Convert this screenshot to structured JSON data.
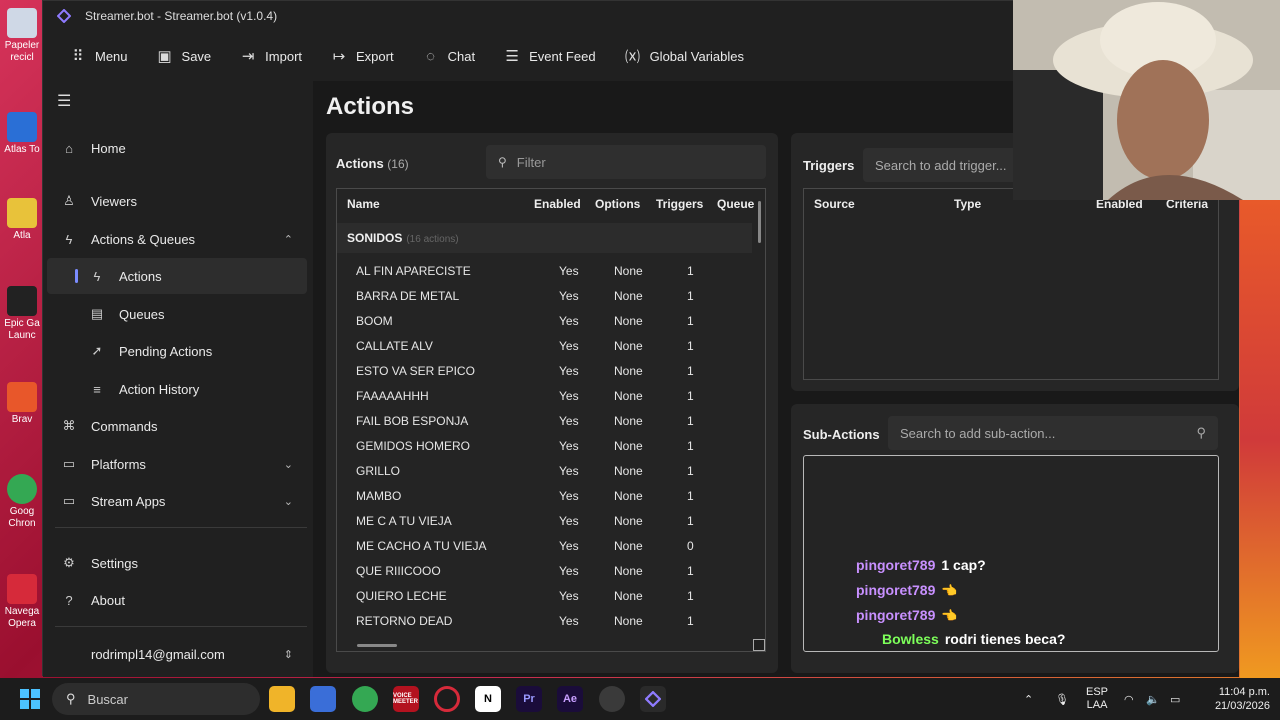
{
  "desktop": {
    "icons": [
      {
        "label": "Papeler recicl",
        "color": "#cfd8e6"
      },
      {
        "label": "Atlas To",
        "color": "#2a6fd6"
      },
      {
        "label": "Atla",
        "color": "#e8c23a"
      },
      {
        "label": "Epic Ga Launc",
        "color": "#222222"
      },
      {
        "label": "Brav",
        "color": "#e8572a"
      },
      {
        "label": "Goog Chron",
        "color": "#34a853"
      },
      {
        "label": "Navega Opera",
        "color": "#d62a3a"
      }
    ]
  },
  "window": {
    "title": "Streamer.bot - Streamer.bot (v1.0.4)",
    "toolbar": [
      {
        "label": "Menu",
        "icon": "grid-icon"
      },
      {
        "label": "Save",
        "icon": "save-icon"
      },
      {
        "label": "Import",
        "icon": "import-icon"
      },
      {
        "label": "Export",
        "icon": "export-icon"
      },
      {
        "label": "Chat",
        "icon": "chat-icon"
      },
      {
        "label": "Event Feed",
        "icon": "event-feed-icon"
      },
      {
        "label": "Global Variables",
        "icon": "variables-icon"
      }
    ]
  },
  "sidebar": {
    "items": [
      {
        "label": "Home"
      },
      {
        "label": "Viewers"
      },
      {
        "label": "Actions & Queues"
      },
      {
        "label": "Actions"
      },
      {
        "label": "Queues"
      },
      {
        "label": "Pending Actions"
      },
      {
        "label": "Action History"
      },
      {
        "label": "Commands"
      },
      {
        "label": "Platforms"
      },
      {
        "label": "Stream Apps"
      },
      {
        "label": "Settings"
      },
      {
        "label": "About"
      }
    ],
    "account": "rodrimpl14@gmail.com"
  },
  "main": {
    "title": "Actions",
    "actions_panel": {
      "title": "Actions",
      "count": "(16)",
      "filter_placeholder": "Filter",
      "columns": [
        "Name",
        "Enabled",
        "Options",
        "Triggers",
        "Queue"
      ],
      "group": {
        "name": "SONIDOS",
        "count": "(16 actions)"
      },
      "rows": [
        {
          "name": "AL FIN APARECISTE",
          "enabled": "Yes",
          "options": "None",
          "triggers": "1"
        },
        {
          "name": "BARRA DE METAL",
          "enabled": "Yes",
          "options": "None",
          "triggers": "1"
        },
        {
          "name": "BOOM",
          "enabled": "Yes",
          "options": "None",
          "triggers": "1"
        },
        {
          "name": "CALLATE ALV",
          "enabled": "Yes",
          "options": "None",
          "triggers": "1"
        },
        {
          "name": "ESTO VA SER EPICO",
          "enabled": "Yes",
          "options": "None",
          "triggers": "1"
        },
        {
          "name": "FAAAAAHHH",
          "enabled": "Yes",
          "options": "None",
          "triggers": "1"
        },
        {
          "name": "FAIL BOB ESPONJA",
          "enabled": "Yes",
          "options": "None",
          "triggers": "1"
        },
        {
          "name": "GEMIDOS HOMERO",
          "enabled": "Yes",
          "options": "None",
          "triggers": "1"
        },
        {
          "name": "GRILLO",
          "enabled": "Yes",
          "options": "None",
          "triggers": "1"
        },
        {
          "name": "MAMBO",
          "enabled": "Yes",
          "options": "None",
          "triggers": "1"
        },
        {
          "name": "ME C A TU VIEJA",
          "enabled": "Yes",
          "options": "None",
          "triggers": "1"
        },
        {
          "name": "ME CACHO A TU VIEJA",
          "enabled": "Yes",
          "options": "None",
          "triggers": "0"
        },
        {
          "name": "QUE RIIICOOO",
          "enabled": "Yes",
          "options": "None",
          "triggers": "1"
        },
        {
          "name": "QUIERO LECHE",
          "enabled": "Yes",
          "options": "None",
          "triggers": "1"
        },
        {
          "name": "RETORNO DEAD",
          "enabled": "Yes",
          "options": "None",
          "triggers": "1"
        }
      ]
    },
    "triggers_panel": {
      "title": "Triggers",
      "search_placeholder": "Search to add trigger...",
      "columns": [
        "Source",
        "Type",
        "Enabled",
        "Criteria"
      ]
    },
    "subactions_panel": {
      "title": "Sub-Actions",
      "search_placeholder": "Search to add sub-action..."
    }
  },
  "chat_overlay": [
    {
      "user": "pingoret789",
      "message": "1 cap?",
      "color": "#c890ff"
    },
    {
      "user": "pingoret789",
      "message": "👈",
      "color": "#c890ff"
    },
    {
      "user": "pingoret789",
      "message": "👈",
      "color": "#c890ff"
    },
    {
      "user": "Bowless",
      "message": "rodri tienes beca?",
      "color": "#7dff5a"
    }
  ],
  "taskbar": {
    "search_placeholder": "Buscar",
    "lang": "ESP",
    "lang_sub": "LAA",
    "time": "11:04 p.m.",
    "date": "21/03/2026",
    "voicemod_label": "VOICE MEETER"
  },
  "colors": {
    "accent": "#7b8cff",
    "bg": "#1f1f1f"
  }
}
